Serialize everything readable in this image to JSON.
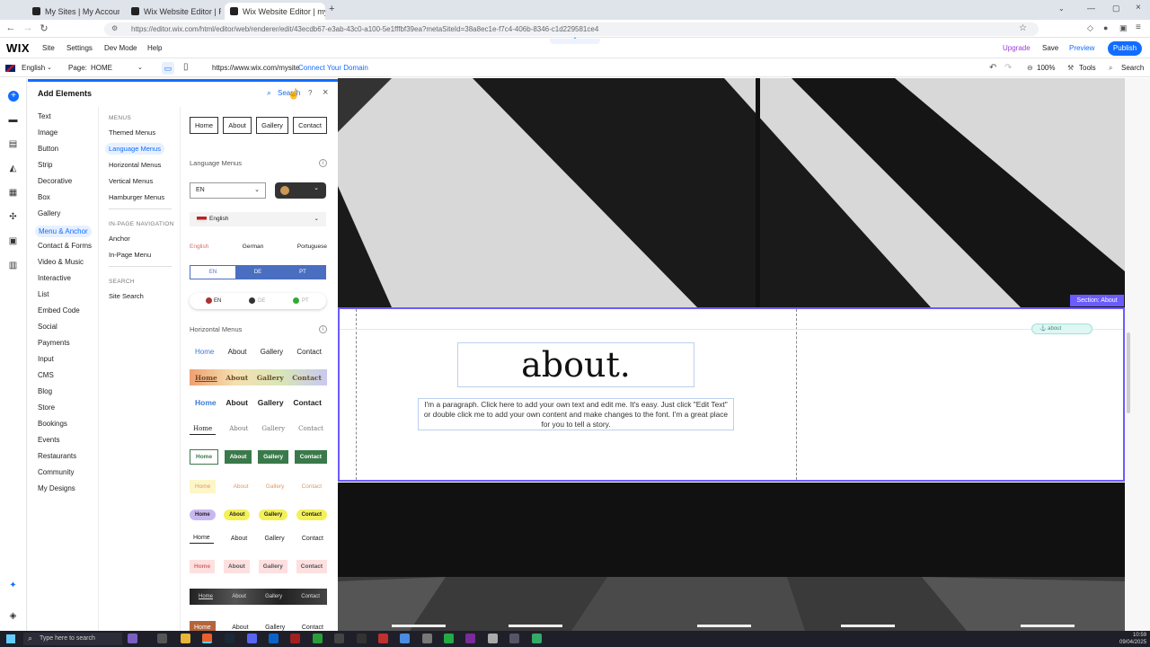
{
  "browser": {
    "tabs": [
      {
        "title": "My Sites | My Account | Wix.co"
      },
      {
        "title": "Wix Website Editor | Rustit"
      },
      {
        "title": "Wix Website Editor | mysite"
      }
    ],
    "new_tab": "+",
    "url": "https://editor.wix.com/html/editor/web/renderer/edit/43ecdb67-e3ab-43c0-a100-5e1fffbf39ea?metaSiteId=38a8ec1e-f7c4-406b-8346-c1d229581ce4"
  },
  "wix_bar": {
    "logo": "WIX",
    "menu": [
      "Site",
      "Settings",
      "Dev Mode",
      "Help"
    ],
    "upgrade": "Upgrade",
    "save": "Save",
    "preview": "Preview",
    "publish": "Publish"
  },
  "editor_bar": {
    "language": "English",
    "page_label": "Page:",
    "page_value": "HOME",
    "site_url": "https://www.wix.com/mysite",
    "connect_domain": "Connect Your Domain",
    "zoom": "100%",
    "tools": "Tools",
    "search": "Search"
  },
  "panel": {
    "title": "Add Elements",
    "search": "Search",
    "help": "?",
    "close": "×",
    "categories": [
      "Text",
      "Image",
      "Button",
      "Strip",
      "Decorative",
      "Box",
      "Gallery",
      "Menu & Anchor",
      "Contact & Forms",
      "Video & Music",
      "Interactive",
      "List",
      "Embed Code",
      "Social",
      "Payments",
      "Input",
      "CMS",
      "Blog",
      "Store",
      "Bookings",
      "Events",
      "Restaurants",
      "Community",
      "My Designs"
    ],
    "sub_menus_header": "MENUS",
    "sub_menus": [
      "Themed Menus",
      "Language Menus",
      "Horizontal Menus",
      "Vertical Menus",
      "Hamburger Menus"
    ],
    "sub_inpage_header": "IN-PAGE NAVIGATION",
    "sub_inpage": [
      "Anchor",
      "In-Page Menu"
    ],
    "sub_search_header": "SEARCH",
    "sub_search": [
      "Site Search"
    ],
    "language_menus_title": "Language Menus",
    "horizontal_menus_title": "Horizontal Menus",
    "lang_dropdown_value": "EN",
    "lang_english": "English",
    "lang_row": [
      "English",
      "German",
      "Portuguese"
    ],
    "lang_codes": [
      "EN",
      "DE",
      "PT"
    ],
    "menu_items": [
      "Home",
      "About",
      "Gallery",
      "Contact"
    ]
  },
  "canvas": {
    "section_label": "Section: About",
    "anchor_label": "about",
    "about_title": "about.",
    "about_paragraph": "I'm a paragraph. Click here to add your own text and edit me. It's easy. Just click \"Edit Text\" or double click me to add your own content and make changes to the font. I'm a great place for you to tell a story."
  },
  "taskbar": {
    "search_placeholder": "Type here to search",
    "time": "10:59",
    "date": "09/04/2025"
  },
  "colors": {
    "accent": "#116dff",
    "section": "#6b5cff",
    "upgrade": "#9b3ddc"
  }
}
